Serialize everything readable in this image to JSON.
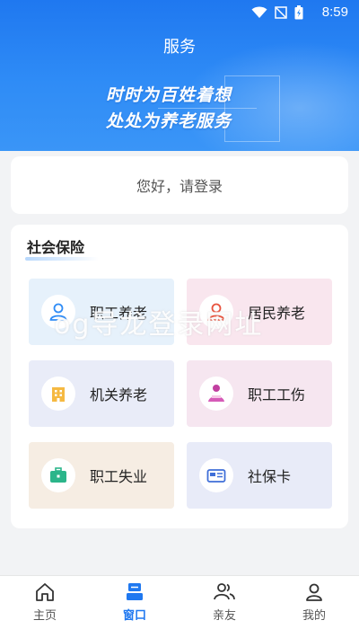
{
  "status_bar": {
    "time": "8:59"
  },
  "header": {
    "title": "服务",
    "slogan_line1": "时时为百姓着想",
    "slogan_line2": "处处为养老服务"
  },
  "login": {
    "prompt": "您好，请登录"
  },
  "social_insurance": {
    "title": "社会保险",
    "tiles": [
      {
        "label": "职工养老",
        "icon": "person-icon"
      },
      {
        "label": "居民养老",
        "icon": "person-icon"
      },
      {
        "label": "机关养老",
        "icon": "building-icon"
      },
      {
        "label": "职工工伤",
        "icon": "injured-worker-icon"
      },
      {
        "label": "职工失业",
        "icon": "briefcase-icon"
      },
      {
        "label": "社保卡",
        "icon": "card-icon"
      }
    ]
  },
  "watermark": "og导龙登录网址",
  "bottom_nav": {
    "items": [
      {
        "label": "主页",
        "icon": "home-icon"
      },
      {
        "label": "窗口",
        "icon": "window-icon"
      },
      {
        "label": "亲友",
        "icon": "people-icon"
      },
      {
        "label": "我的",
        "icon": "user-icon"
      }
    ],
    "active": "窗口"
  },
  "colors": {
    "accent": "#1f78f0",
    "header_bg": "#2f8cf6"
  }
}
